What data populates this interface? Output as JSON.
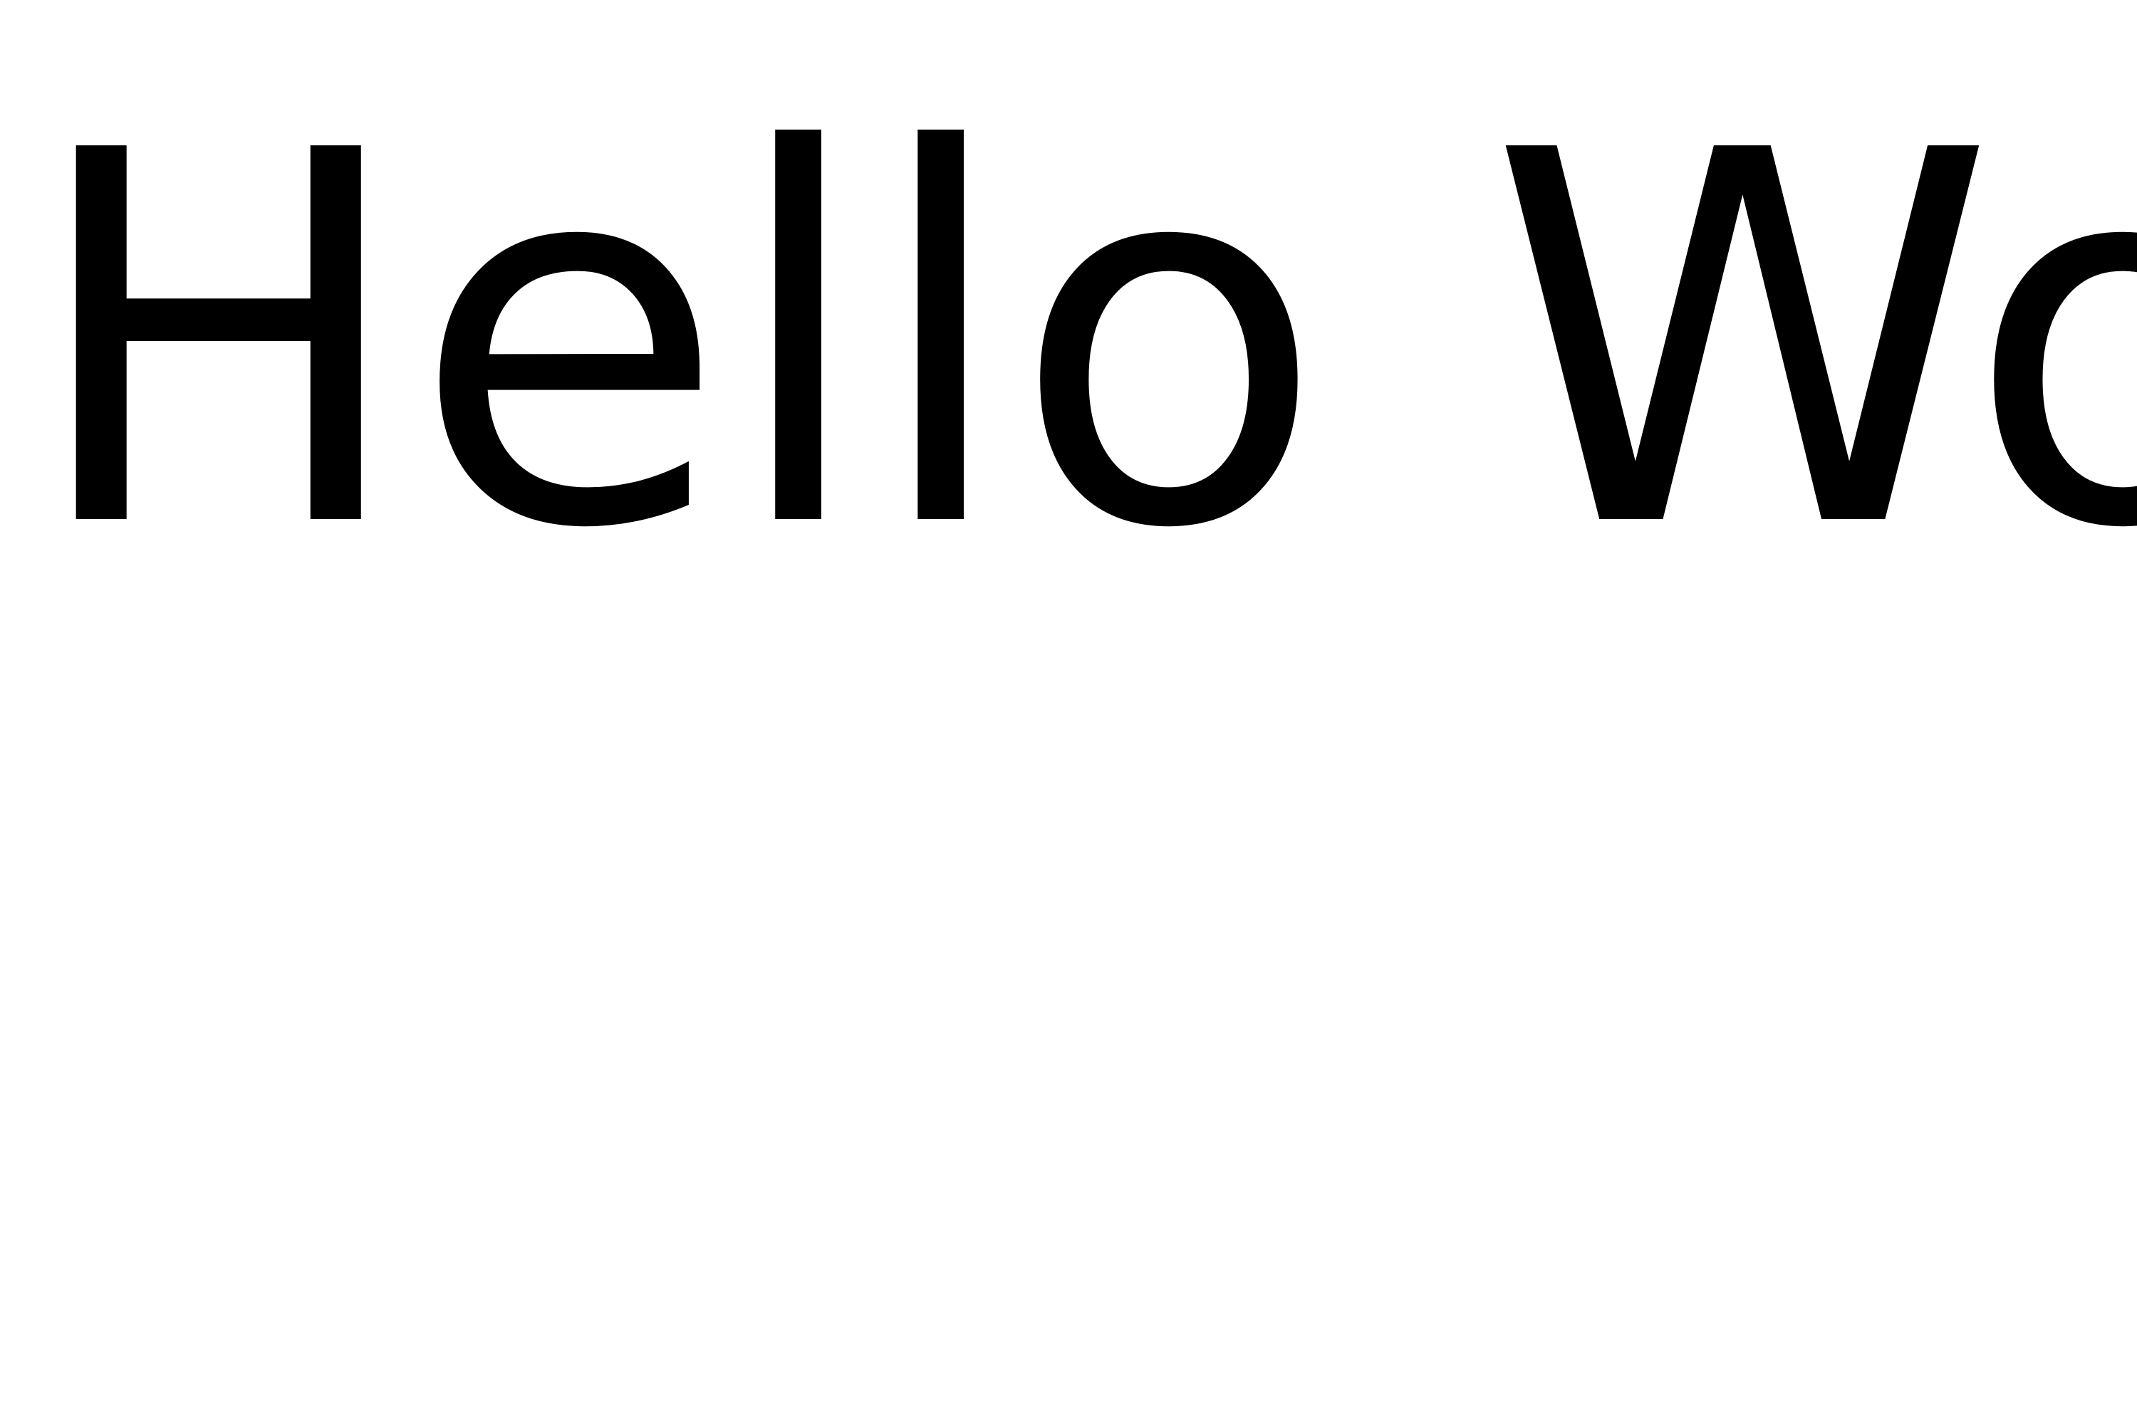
{
  "page": {
    "heading": "Hello Wo",
    "background": "#ffffff",
    "text_color": "#000000"
  }
}
